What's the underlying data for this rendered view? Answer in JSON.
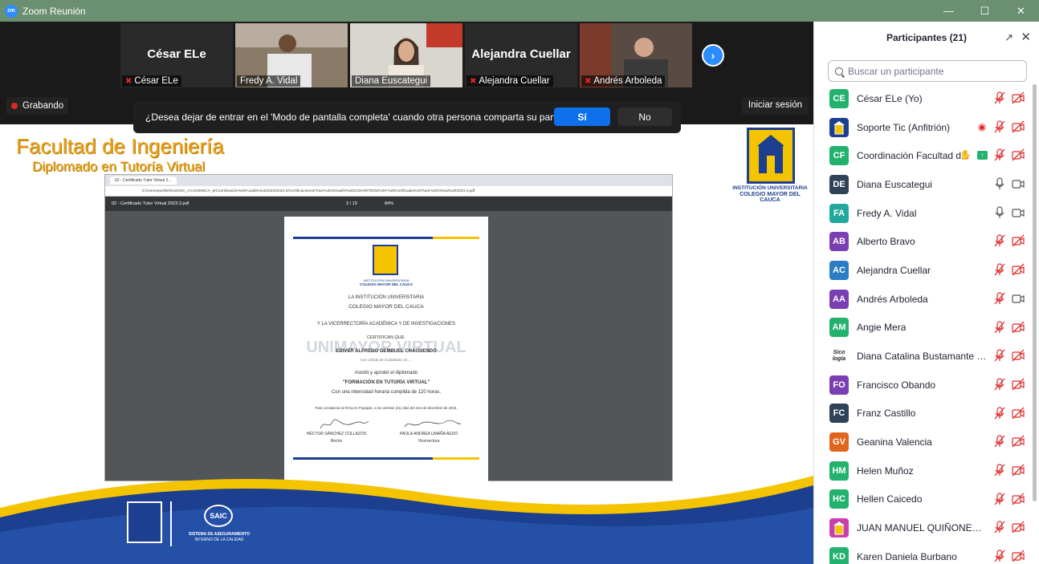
{
  "window": {
    "title": "Zoom Reunión",
    "logo_text": "zm",
    "minimize": "—",
    "maximize": "☐",
    "close": "✕"
  },
  "video_strip": {
    "tiles": [
      {
        "big_name": "César ELe",
        "name": "César ELe",
        "muted": true
      },
      {
        "big_name": "",
        "name": "Fredy A. Vidal",
        "muted": false
      },
      {
        "big_name": "",
        "name": "Diana Euscategui",
        "muted": false
      },
      {
        "big_name": "Alejandra Cuellar",
        "name": "Alejandra Cuellar",
        "muted": true
      },
      {
        "big_name": "",
        "name": "Andrés Arboleda",
        "muted": true
      }
    ],
    "next_glyph": "›"
  },
  "recording": {
    "label": "Grabando"
  },
  "sign_in": {
    "label": "Iniciar sesión"
  },
  "prompt": {
    "text": "¿Desea dejar de entrar en el 'Modo de pantalla completa' cuando otra persona comparta su pantalla?",
    "yes": "Sí",
    "no": "No"
  },
  "slide": {
    "title": "Facultad de Ingeniería",
    "subtitle": "Diplomado en Tutoría Virtual",
    "logo_line1": "INSTITUCIÓN UNIVERSITARIA",
    "logo_line2": "COLEGIO MAYOR DEL CAUCA",
    "browser": {
      "tab": "02 - Certificado Tutor Virtual 2...",
      "url": "D:/cienvepo/DE9%20SIC_ACADEMICA_6/Coordinación%20Académica/2023/2023-2/Certificaciones/Tutor%20Virtual/X%20COHORTE/02%20-%20Certificado%20Tutor%20Virtual%202023-2.pdf",
      "pdf_name": "02 - Certificado Tutor Virtual 2023-2.pdf",
      "page": "3 / 19",
      "zoom": "84%"
    },
    "certificate": {
      "logo_l1": "INSTITUCIÓN UNIVERSITARIA",
      "logo_l2": "COLEGIO MAYOR DEL CAUCA",
      "line1": "LA INSTITUCIÓN UNIVERSITARIA",
      "line2": "COLEGIO MAYOR DEL CAUCA",
      "line3": "Y LA VICERRECTORÍA ACADÉMICA Y DE INVESTIGACIONES",
      "line4": "CERTIFICAN QUE:",
      "name": "EDIVER ALFREDO GEMBUEL CHAGUENDO",
      "id": "Con cédula de ciudadanía 10.....",
      "watermark": "UNIMAYOR VIRTUAL",
      "line5": "Asistió y aprobó el diplomado",
      "course": "\"FORMACIÓN EN TUTORÍA VIRTUAL\"",
      "hours": "Con una intensidad horaria cumplida de 120 horas.",
      "closing": "Para constancia se firma en Popayán, a los veintiún (21) días del mes de diciembre de 2023.",
      "sig1_name": "HÉCTOR SÁNCHEZ COLLAZOS",
      "sig1_role": "Rector",
      "sig2_name": "PAOLA ANDREA UMAÑA AEDO",
      "sig2_role": "Vicerrectora"
    },
    "saic_label": "SAIC",
    "saic_l1": "SISTEMA DE ASEGURAMIENTO",
    "saic_l2": "INTERNO DE LA CALIDAD"
  },
  "participants": {
    "title": "Participantes (21)",
    "search_placeholder": "Buscar un participante",
    "list": [
      {
        "initials": "CE",
        "color": "#23b26d",
        "name": "César ELe (Yo)",
        "mic": "muted",
        "video": "off"
      },
      {
        "initials": "",
        "color": "#1d3f8f",
        "name": "Soporte Tic (Anfitrión)",
        "mic": "muted",
        "video": "off",
        "recording": true
      },
      {
        "initials": "CF",
        "color": "#23b26d",
        "name": "Coordinación Facultad d...",
        "mic": "muted",
        "video": "off",
        "clap": true,
        "share": true
      },
      {
        "initials": "DE",
        "color": "#2f4358",
        "name": "Diana Euscategui",
        "mic": "on",
        "video": "on"
      },
      {
        "initials": "FA",
        "color": "#23a8a0",
        "name": "Fredy A. Vidal",
        "mic": "on",
        "video": "on"
      },
      {
        "initials": "AB",
        "color": "#7b3fb4",
        "name": "Alberto Bravo",
        "mic": "muted",
        "video": "off"
      },
      {
        "initials": "AC",
        "color": "#2a7dc4",
        "name": "Alejandra Cuellar",
        "mic": "muted",
        "video": "off"
      },
      {
        "initials": "AA",
        "color": "#7b3fb4",
        "name": "Andrés Arboleda",
        "mic": "muted",
        "video": "on"
      },
      {
        "initials": "AM",
        "color": "#23b26d",
        "name": "Angie Mera",
        "mic": "muted",
        "video": "off"
      },
      {
        "initials": "",
        "color": "#ffffff",
        "name": "Diana Catalina Bustamante Man...",
        "mic": "muted",
        "video": "off",
        "logo": "Sico logía"
      },
      {
        "initials": "FO",
        "color": "#7b3fb4",
        "name": "Francisco Obando",
        "mic": "muted",
        "video": "off"
      },
      {
        "initials": "FC",
        "color": "#2f4358",
        "name": "Franz Castillo",
        "mic": "muted",
        "video": "off"
      },
      {
        "initials": "GV",
        "color": "#e0661e",
        "name": "Geanina Valencia",
        "mic": "muted",
        "video": "off"
      },
      {
        "initials": "HM",
        "color": "#23b26d",
        "name": "Helen Muñoz",
        "mic": "muted",
        "video": "off"
      },
      {
        "initials": "HC",
        "color": "#23b26d",
        "name": "Hellen Caicedo",
        "mic": "muted",
        "video": "off"
      },
      {
        "initials": "",
        "color": "#c93fb0",
        "name": "JUAN MANUEL QUIÑONES LOP...",
        "mic": "muted",
        "video": "off"
      },
      {
        "initials": "KD",
        "color": "#23b26d",
        "name": "Karen Daniela Burbano",
        "mic": "muted",
        "video": "off"
      }
    ]
  }
}
